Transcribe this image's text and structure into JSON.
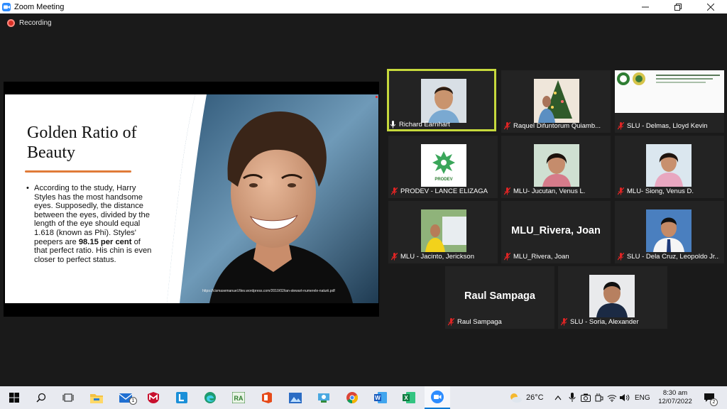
{
  "window": {
    "title": "Zoom Meeting"
  },
  "recording": {
    "label": "Recording"
  },
  "share": {
    "slide_title": "Golden Ratio of Beauty",
    "body_before": "According to the study, Harry Styles has the most handsome eyes. Supposedly, the distance between the eyes, divided by the length of the eye should equal 1.618 (known as Phi). Styles' peepers are ",
    "body_bold": "98.15 per cent",
    "body_after": " of that perfect ratio. His chin is even closer to perfect status.",
    "credit": "https://cismasemanuel.files.wordpress.com/2010/02/ian-stewart-numerele-naturii.pdf"
  },
  "participants": [
    {
      "name": "Richard Earnhart",
      "muted": false,
      "video": "photo",
      "active": true
    },
    {
      "name": "Raquel Difuntorum Quiamb...",
      "muted": true,
      "video": "photo"
    },
    {
      "name": "SLU - Delmas, Lloyd Kevin",
      "muted": true,
      "video": "screen"
    },
    {
      "name": "PRODEV - LANCE ELIZAGA",
      "muted": true,
      "video": "logo",
      "logo_text": "PRODEV"
    },
    {
      "name": "MLU- Jucutan, Venus L.",
      "muted": true,
      "video": "photo"
    },
    {
      "name": "MLU- Siong, Venus D.",
      "muted": true,
      "video": "photo"
    },
    {
      "name": "MLU - Jacinto, Jerickson",
      "muted": true,
      "video": "photo"
    },
    {
      "name": "MLU_Rivera, Joan",
      "muted": true,
      "video": "name",
      "display_name": "MLU_Rivera, Joan"
    },
    {
      "name": "SLU - Dela Cruz, Leopoldo Jr....",
      "muted": true,
      "video": "photo"
    },
    {
      "name": "Raul Sampaga",
      "muted": true,
      "video": "name",
      "display_name": "Raul Sampaga"
    },
    {
      "name": "SLU - Soria, Alexander",
      "muted": true,
      "video": "photo"
    }
  ],
  "taskbar": {
    "mail_badge": "1",
    "weather": "26°C",
    "language": "ENG",
    "time": "8:30 am",
    "date": "12/07/2022",
    "notifications": "2"
  },
  "colors": {
    "active_speaker": "#c6d93c",
    "muted": "#e02424",
    "recording": "#d93025",
    "zoom_blue": "#2d8cff"
  }
}
